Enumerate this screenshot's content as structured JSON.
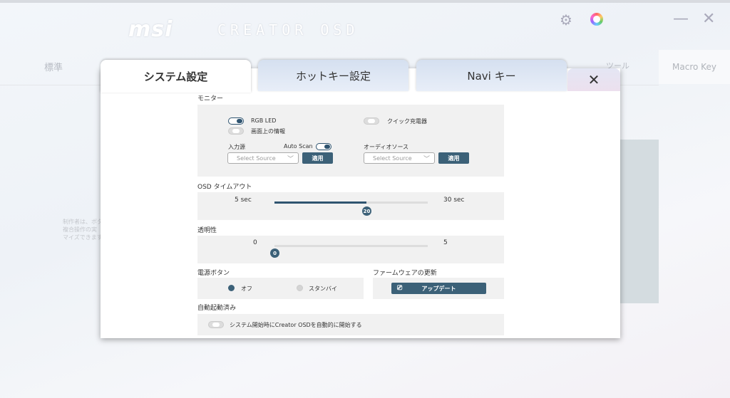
{
  "app": {
    "logo_brand": "msi",
    "logo_product": "CREATOR OSD",
    "icons": {
      "settings": "gear-icon",
      "color": "color-wheel-icon",
      "minimize": "minimize-icon",
      "close": "close-icon"
    }
  },
  "background": {
    "tab_standard": "標準",
    "tab_tool": "ツール",
    "tab_macro": "Macro Key",
    "desc_lines": [
      "制作者は、ボタ",
      "複合操作の実",
      "マイズできます"
    ]
  },
  "dialog": {
    "tabs": [
      {
        "label": "システム設定",
        "active": true
      },
      {
        "label": "ホットキー設定",
        "active": false
      },
      {
        "label": "Navi キー",
        "active": false
      }
    ],
    "close_label": "✕",
    "monitor": {
      "title": "モニター",
      "rgb_led": {
        "label": "RGB LED",
        "on": true
      },
      "quick_charge": {
        "label": "クイック充電器",
        "on": false
      },
      "onscreen_info": {
        "label": "画面上の情報",
        "on": false
      },
      "input_source": {
        "label": "入力源",
        "auto_scan_label": "Auto Scan",
        "auto_scan_on": true,
        "placeholder": "Select Source",
        "apply": "適用"
      },
      "audio_source": {
        "label": "オーディオソース",
        "placeholder": "Select Source",
        "apply": "適用"
      }
    },
    "osd_timeout": {
      "title": "OSD タイムアウト",
      "min_label": "5 sec",
      "max_label": "30 sec",
      "min": 5,
      "max": 30,
      "value": 20,
      "value_label": "20"
    },
    "transparency": {
      "title": "透明性",
      "min_label": "0",
      "max_label": "5",
      "min": 0,
      "max": 5,
      "value": 0,
      "value_label": "0"
    },
    "power_button": {
      "title": "電源ボタン",
      "options": [
        {
          "label": "オフ",
          "selected": true
        },
        {
          "label": "スタンバイ",
          "selected": false
        }
      ]
    },
    "firmware": {
      "title": "ファームウェアの更新",
      "update_label": "アップデート"
    },
    "autostart": {
      "title": "自動起動済み",
      "label": "システム開始時にCreator OSDを自動的に開始する",
      "on": false
    },
    "accent": "#3c6178"
  }
}
